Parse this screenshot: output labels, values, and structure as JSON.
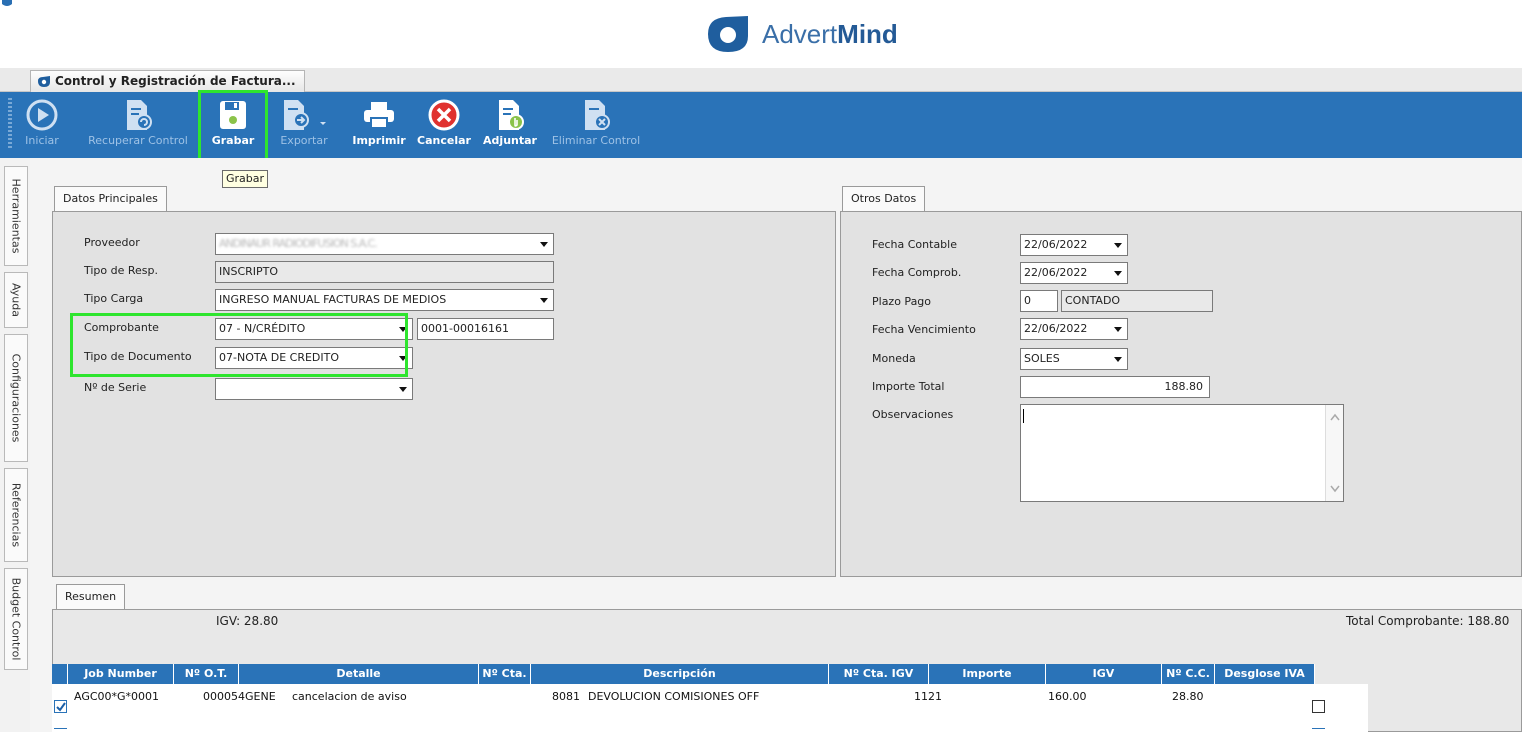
{
  "brand": {
    "name_light": "Advert",
    "name_bold": "Mind"
  },
  "document_tab": {
    "label": "Control y Registración de Factura..."
  },
  "toolbar": {
    "buttons": [
      {
        "label": "Iniciar",
        "enabled": false
      },
      {
        "label": "Recuperar Control",
        "enabled": false
      },
      {
        "label": "Grabar",
        "enabled": true
      },
      {
        "label": "Exportar",
        "enabled": false
      },
      {
        "label": "Imprimir",
        "enabled": true
      },
      {
        "label": "Cancelar",
        "enabled": true
      },
      {
        "label": "Adjuntar",
        "enabled": true
      },
      {
        "label": "Eliminar Control",
        "enabled": false
      }
    ],
    "tooltip": "Grabar"
  },
  "side_tabs": [
    "Herramientas",
    "Ayuda",
    "Configuraciones",
    "Referencias",
    "Budget Control"
  ],
  "datos_principales": {
    "tab_label": "Datos Principales",
    "proveedor": {
      "label": "Proveedor",
      "value": "ANDINAUR RADIODIFUSION S.A.C."
    },
    "tipo_resp": {
      "label": "Tipo de Resp.",
      "value": "INSCRIPTO"
    },
    "tipo_carga": {
      "label": "Tipo Carga",
      "value": "INGRESO MANUAL FACTURAS DE MEDIOS"
    },
    "comprobante": {
      "label": "Comprobante",
      "value": "07 - N/CRÉDITO",
      "numero": "0001-00016161"
    },
    "tipo_documento": {
      "label": "Tipo de Documento",
      "value": "07-NOTA DE CREDITO"
    },
    "nro_serie": {
      "label": "Nº de Serie",
      "value": ""
    }
  },
  "otros_datos": {
    "tab_label": "Otros Datos",
    "fecha_contable": {
      "label": "Fecha Contable",
      "value": "22/06/2022"
    },
    "fecha_comprob": {
      "label": "Fecha Comprob.",
      "value": "22/06/2022"
    },
    "plazo_pago": {
      "label": "Plazo Pago",
      "dias": "0",
      "descripcion": "CONTADO"
    },
    "fecha_vencimiento": {
      "label": "Fecha Vencimiento",
      "value": "22/06/2022"
    },
    "moneda": {
      "label": "Moneda",
      "value": "SOLES"
    },
    "importe_total": {
      "label": "Importe Total",
      "value": "188.80"
    },
    "observaciones": {
      "label": "Observaciones",
      "value": ""
    }
  },
  "resumen": {
    "tab_label": "Resumen",
    "igv": "IGV: 28.80",
    "total_comprobante": "Total Comprobante: 188.80"
  },
  "grid": {
    "columns": [
      "Job Number",
      "Nº O.T.",
      "Detalle",
      "Nº Cta.",
      "Descripción",
      "Nº Cta. IGV",
      "Importe",
      "IGV",
      "Nº C.C.",
      "Desglose IVA"
    ],
    "rows": [
      {
        "selected": true,
        "job_number": "AGC00*G*0001",
        "ot": "000054GENE",
        "detalle": "cancelacion de aviso",
        "cta": "8081",
        "descripcion": "DEVOLUCION COMISIONES OFF",
        "cta_igv": "1121",
        "importe": "160.00",
        "igv": "28.80",
        "cc": "",
        "desglose_iva": false
      }
    ]
  },
  "colors": {
    "ribbon": "#2a73b8",
    "highlight": "#2ee52e"
  }
}
